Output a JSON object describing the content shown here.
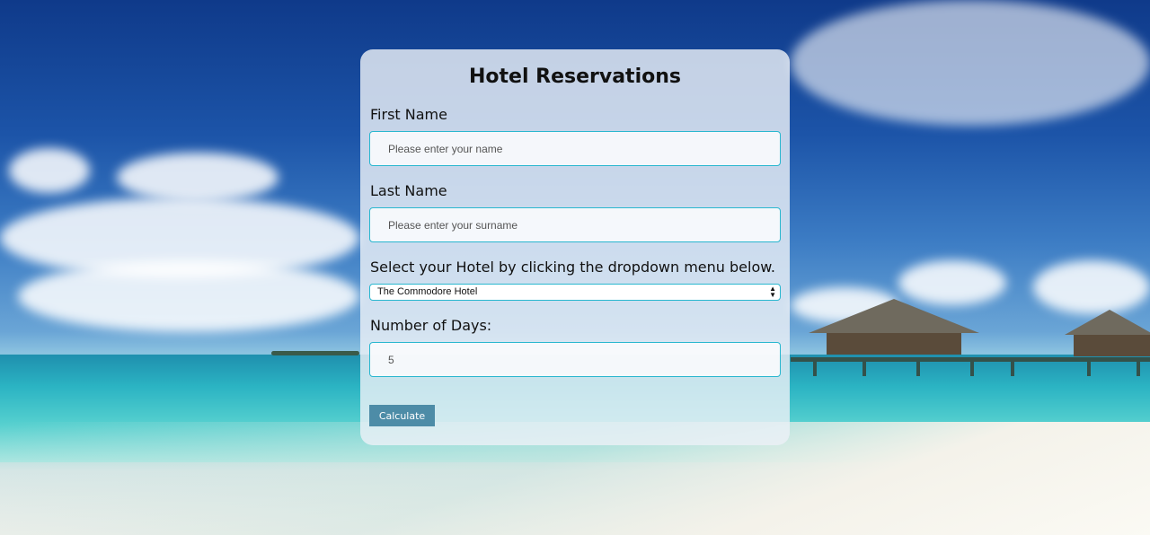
{
  "form": {
    "title": "Hotel Reservations",
    "first_name": {
      "label": "First Name",
      "placeholder": "Please enter your name",
      "value": ""
    },
    "last_name": {
      "label": "Last Name",
      "placeholder": "Please enter your surname",
      "value": ""
    },
    "hotel": {
      "label": "Select your Hotel by clicking the dropdown menu below.",
      "selected": "The Commodore Hotel"
    },
    "days": {
      "label": "Number of Days:",
      "value": "5"
    },
    "calculate_label": "Calculate"
  },
  "colors": {
    "input_border": "#29b7cf",
    "button_bg": "#4d8ca7",
    "card_bg": "#ecf0f6"
  },
  "icons": {
    "select_arrows": "updown-arrows-icon"
  }
}
